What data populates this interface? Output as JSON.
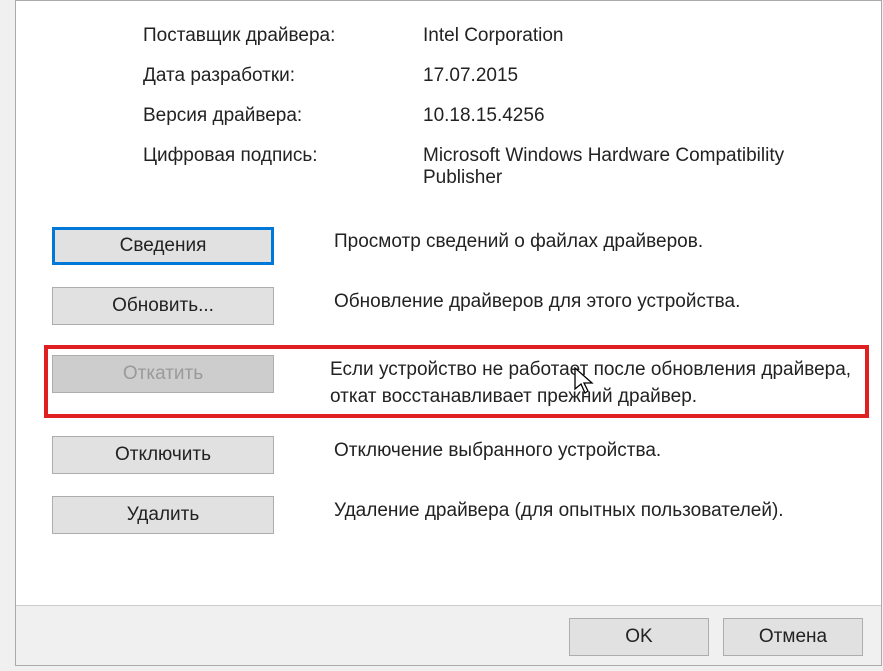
{
  "info": {
    "provider_label": "Поставщик драйвера:",
    "provider_value": "Intel Corporation",
    "date_label": "Дата разработки:",
    "date_value": "17.07.2015",
    "version_label": "Версия драйвера:",
    "version_value": "10.18.15.4256",
    "signature_label": "Цифровая подпись:",
    "signature_value": "Microsoft Windows Hardware Compatibility Publisher"
  },
  "actions": {
    "details": {
      "label": "Сведения",
      "desc": "Просмотр сведений о файлах драйверов."
    },
    "update": {
      "label": "Обновить...",
      "desc": "Обновление драйверов для этого устройства."
    },
    "rollback": {
      "label": "Откатить",
      "desc": "Если устройство не работает после обновления драйвера, откат восстанавливает прежний драйвер."
    },
    "disable": {
      "label": "Отключить",
      "desc": "Отключение выбранного устройства."
    },
    "delete": {
      "label": "Удалить",
      "desc": "Удаление драйвера (для опытных пользователей)."
    }
  },
  "footer": {
    "ok": "OK",
    "cancel": "Отмена"
  }
}
